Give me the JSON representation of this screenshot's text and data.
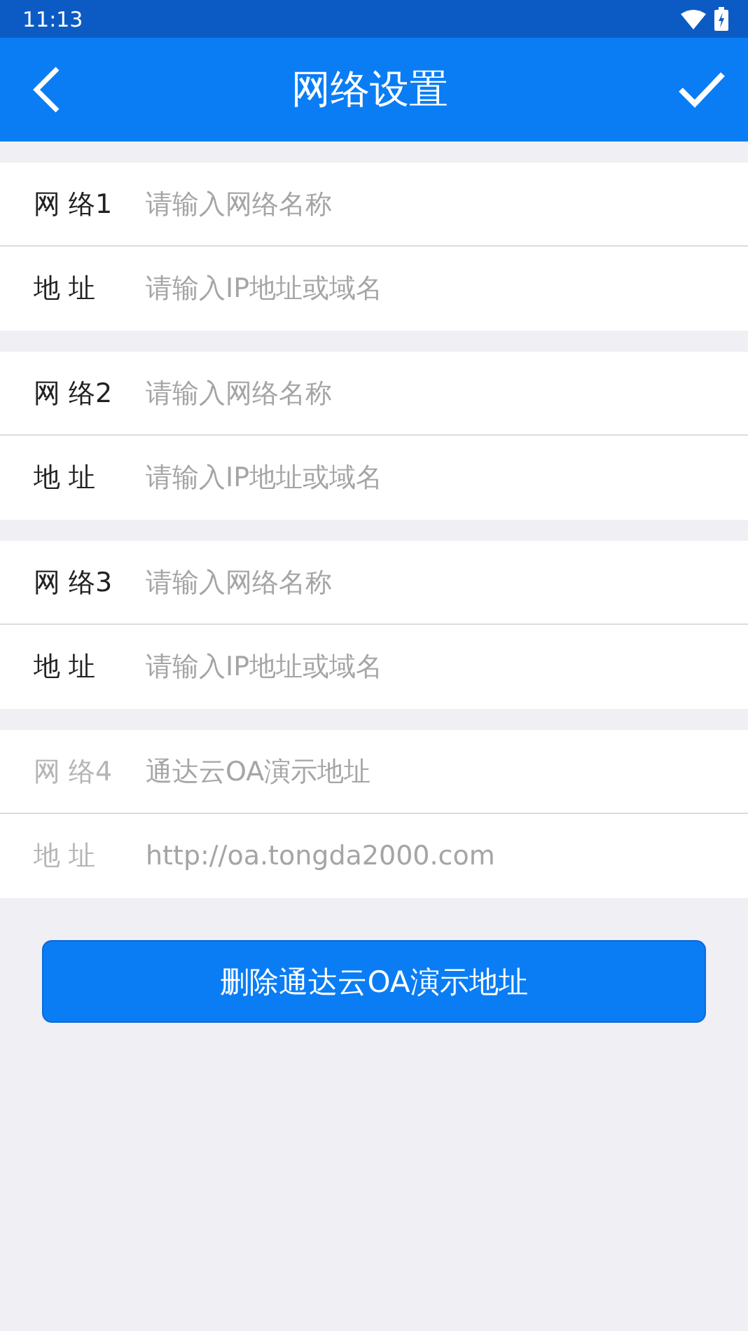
{
  "status_bar": {
    "time": "11:13"
  },
  "header": {
    "title": "网络设置"
  },
  "groups": [
    {
      "disabled": false,
      "fields": [
        {
          "label": "网 络1",
          "placeholder": "请输入网络名称"
        },
        {
          "label": "地 址",
          "placeholder": "请输入IP地址或域名"
        }
      ]
    },
    {
      "disabled": false,
      "fields": [
        {
          "label": "网 络2",
          "placeholder": "请输入网络名称"
        },
        {
          "label": "地 址",
          "placeholder": "请输入IP地址或域名"
        }
      ]
    },
    {
      "disabled": false,
      "fields": [
        {
          "label": "网 络3",
          "placeholder": "请输入网络名称"
        },
        {
          "label": "地 址",
          "placeholder": "请输入IP地址或域名"
        }
      ]
    },
    {
      "disabled": true,
      "fields": [
        {
          "label": "网 络4",
          "value": "通达云OA演示地址"
        },
        {
          "label": "地 址",
          "value": "http://oa.tongda2000.com"
        }
      ]
    }
  ],
  "delete_button": "删除通达云OA演示地址"
}
